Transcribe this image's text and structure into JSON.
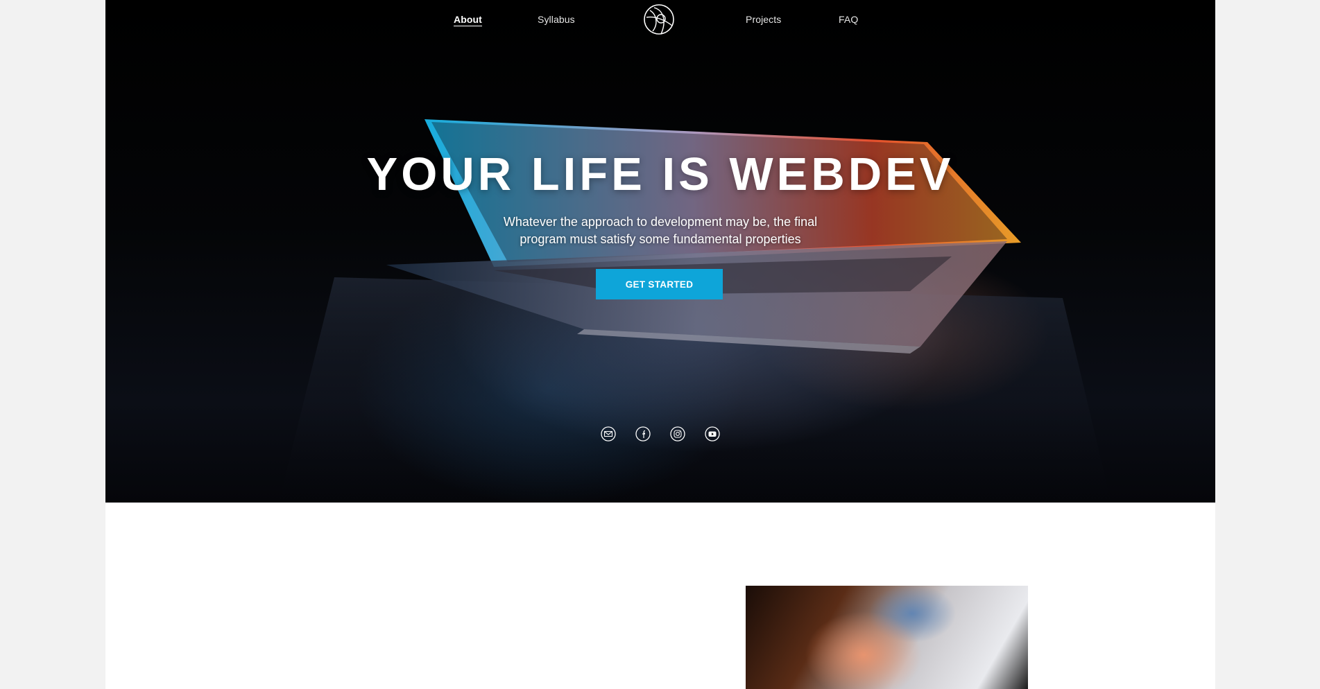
{
  "nav": {
    "about": "About",
    "syllabus": "Syllabus",
    "projects": "Projects",
    "faq": "FAQ",
    "logo_icon": "globe-logo-icon"
  },
  "hero": {
    "title": "YOUR LIFE IS WEBDEV",
    "subtitle": "Whatever the approach to development may be, the final program must satisfy some fundamental properties",
    "cta_label": "GET STARTED",
    "cta_color": "#0ea5d9",
    "background": "dark-laptop-photo"
  },
  "social": [
    {
      "icon": "mail-icon"
    },
    {
      "icon": "facebook-icon"
    },
    {
      "icon": "instagram-icon"
    },
    {
      "icon": "youtube-icon"
    }
  ],
  "colors": {
    "page_bg": "#f2f2f2",
    "content_bg": "#ffffff",
    "accent": "#0ea5d9"
  }
}
